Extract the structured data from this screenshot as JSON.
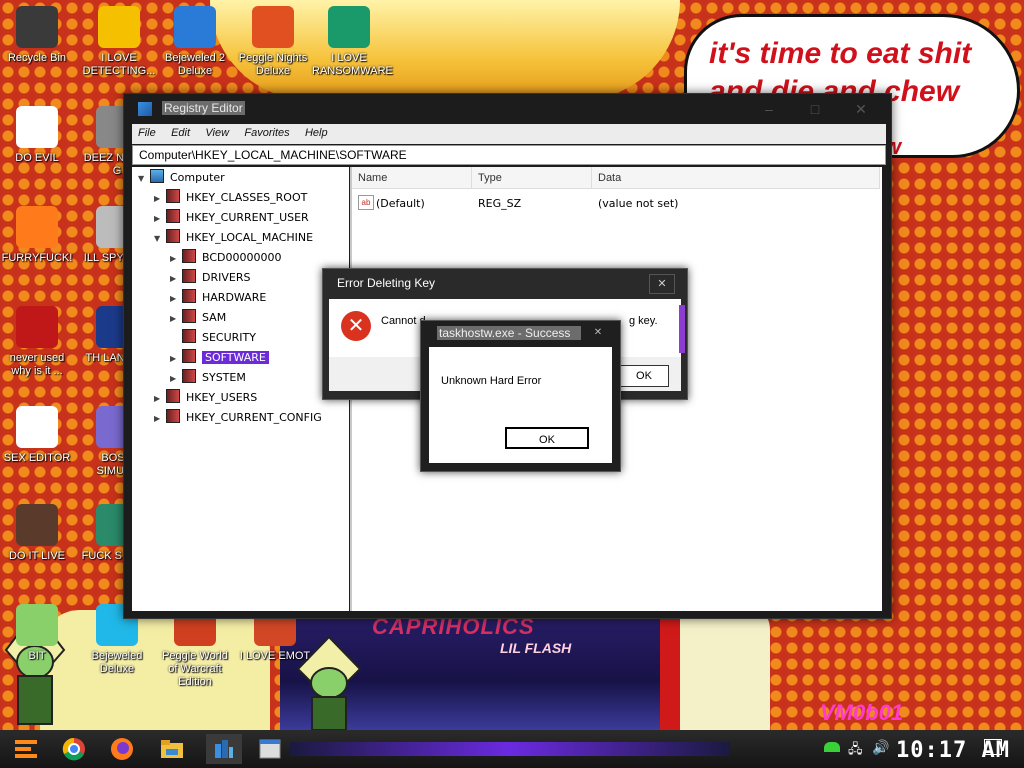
{
  "desktop_icons": [
    {
      "label": "Recycle Bin",
      "icon": "recycle-bin-icon",
      "color": "#3a3a3a"
    },
    {
      "label": "I LOVE DETECTING...",
      "icon": "de-icon",
      "color": "#f4c000"
    },
    {
      "label": "Bejeweled 2 Deluxe",
      "icon": "bejeweled-icon",
      "color": "#2a7bd8"
    },
    {
      "label": "Peggle Nights Deluxe",
      "icon": "peggle-icon",
      "color": "#e05020"
    },
    {
      "label": "I LOVE RANSOMWARE",
      "icon": "publisher-icon",
      "color": "#1a9a6a"
    },
    {
      "label": "DO EVIL",
      "icon": "chrome-icon",
      "color": "#ffffff"
    },
    {
      "label": "DEEZ N HAH G",
      "icon": "file-icon",
      "color": "#888888"
    },
    {
      "label": "FURRYFUCK!",
      "icon": "firefox-icon",
      "color": "#ff7a1a"
    },
    {
      "label": "ILL SPY YOU",
      "icon": "spy-icon",
      "color": "#bcbcbc"
    },
    {
      "label": "never used why is it ...",
      "icon": "devcpp-icon",
      "color": "#c01818"
    },
    {
      "label": "TH LANGUA",
      "icon": "go-icon",
      "color": "#1c3a8a"
    },
    {
      "label": "SEX EDITOR",
      "icon": "hxd-icon",
      "color": "#ffffff"
    },
    {
      "label": "BOSN SIMULA",
      "icon": "ball-icon",
      "color": "#7a6ad0"
    },
    {
      "label": "DO IT LIVE",
      "icon": "portrait-icon",
      "color": "#5a3a2a"
    },
    {
      "label": "FUCK S ELVE",
      "icon": "elf-icon",
      "color": "#2a8a6a"
    },
    {
      "label": "BIT",
      "icon": "peridot-icon",
      "color": "#8ad06a"
    },
    {
      "label": "Bejeweled Deluxe",
      "icon": "gem-icon",
      "color": "#20b8e8"
    },
    {
      "label": "Peggle World of Warcraft Edition",
      "icon": "peggle-wow-icon",
      "color": "#d04020"
    },
    {
      "label": "I LOVE EMOT",
      "icon": "powerpoint-icon",
      "color": "#d24726"
    }
  ],
  "background": {
    "speech_text": "it's time to eat shit and die and chew",
    "speech_tail": "w",
    "album_title": "CAPRIHOLICS",
    "album_sub": "LIL FLASH",
    "tag": "VM0b01"
  },
  "regedit": {
    "title": "Registry Editor",
    "menu": [
      "File",
      "Edit",
      "View",
      "Favorites",
      "Help"
    ],
    "address": "Computer\\HKEY_LOCAL_MACHINE\\SOFTWARE",
    "tree": {
      "root": "Computer",
      "hkcr": "HKEY_CLASSES_ROOT",
      "hkcu": "HKEY_CURRENT_USER",
      "hklm": "HKEY_LOCAL_MACHINE",
      "bcd": "BCD00000000",
      "drivers": "DRIVERS",
      "hardware": "HARDWARE",
      "sam": "SAM",
      "security": "SECURITY",
      "software": "SOFTWARE",
      "system": "SYSTEM",
      "hku": "HKEY_USERS",
      "hkcc": "HKEY_CURRENT_CONFIG"
    },
    "columns": {
      "name": "Name",
      "type": "Type",
      "data": "Data"
    },
    "rows": [
      {
        "name": "(Default)",
        "type": "REG_SZ",
        "data": "(value not set)"
      }
    ]
  },
  "error_dialog": {
    "title": "Error Deleting Key",
    "message_start": "Cannot d",
    "message_end": "g key.",
    "ok": "OK",
    "close": "✕"
  },
  "success_dialog": {
    "title": "taskhostw.exe - Success",
    "message": "Unknown Hard Error",
    "ok": "OK",
    "close": "✕"
  },
  "taskbar": {
    "clock": "10:17 AM",
    "accent": "#6a2ae0"
  }
}
